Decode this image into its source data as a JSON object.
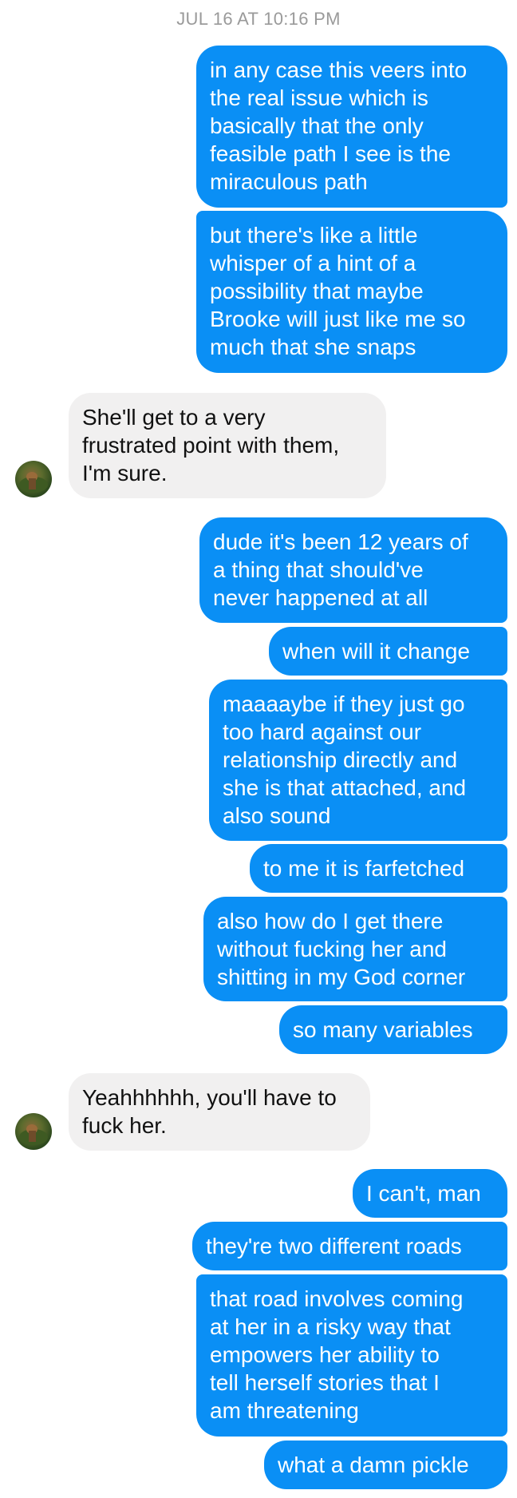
{
  "thread": {
    "timestamp": "JUL 16 AT 10:16 PM"
  },
  "messages": [
    {
      "sender": "me",
      "text": "in any case this veers into\nthe real issue which is\nbasically that the only\nfeasible path I see is the\nmiraculous path"
    },
    {
      "sender": "me",
      "text": "but there's like a little\nwhisper of a hint of a\npossibility that maybe\nBrooke will just like me so\nmuch that she snaps"
    },
    {
      "sender": "them",
      "text": "She'll get to a very\nfrustrated point with them,\nI'm sure."
    },
    {
      "sender": "me",
      "text": "dude it's been 12 years of\na thing that should've\nnever happened at all"
    },
    {
      "sender": "me",
      "text": "when will it change"
    },
    {
      "sender": "me",
      "text": "maaaaybe if they just go\ntoo hard against our\nrelationship directly and\nshe is that attached, and\nalso sound"
    },
    {
      "sender": "me",
      "text": "to me it is farfetched"
    },
    {
      "sender": "me",
      "text": "also how do I get there\nwithout fucking her and\nshitting in my God corner"
    },
    {
      "sender": "me",
      "text": "so many variables"
    },
    {
      "sender": "them",
      "text": "Yeahhhhhh, you'll have to\nfuck her."
    },
    {
      "sender": "me",
      "text": "I can't, man"
    },
    {
      "sender": "me",
      "text": "they're two different roads"
    },
    {
      "sender": "me",
      "text": "that road involves coming\nat her in a risky way that\nempowers her ability to\ntell herself stories that I\nam threatening"
    },
    {
      "sender": "me",
      "text": "what a damn pickle"
    }
  ],
  "colors": {
    "outgoing_bubble": "#0a8ff5",
    "incoming_bubble": "#f1f0f0",
    "timestamp_text": "#9a9a9a"
  },
  "icons": {
    "contact_avatar": "avatar-photo-icon"
  }
}
